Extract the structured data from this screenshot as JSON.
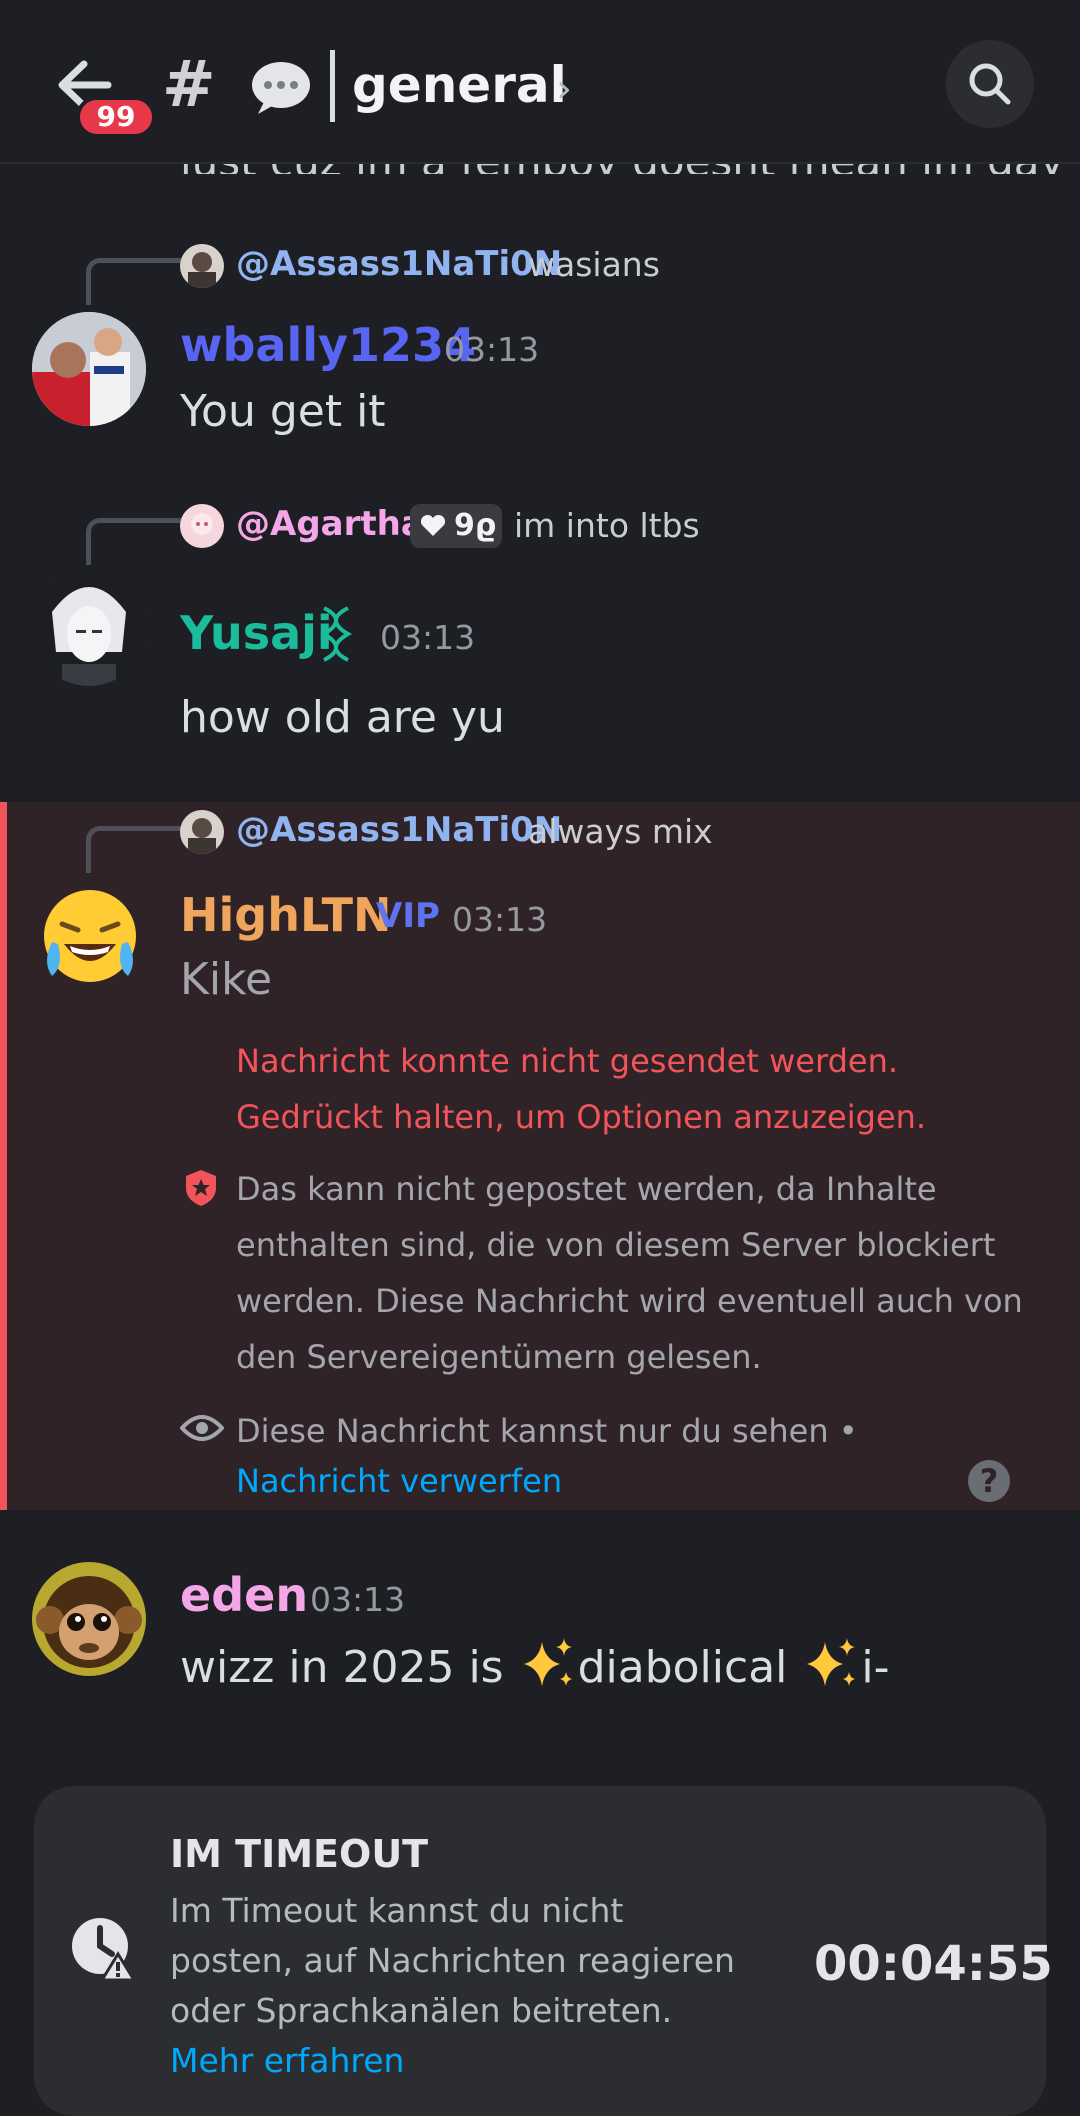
{
  "header": {
    "badge_count": "99",
    "hash": "#",
    "channel_name": "general",
    "chevron": "›"
  },
  "cut_off_message": "just cuz im a femboy doesnt mean im gay",
  "messages": [
    {
      "reply": {
        "mention": "@Assass1NaTi0N",
        "text": "wasians"
      },
      "username": "wbally1234",
      "time": "03:13",
      "text": "You get it"
    },
    {
      "reply": {
        "mention": "@Agartha",
        "tag": "9ϱ",
        "text": "im into ltbs"
      },
      "username": "Yusaji",
      "time": "03:13",
      "text": "how old are yu"
    },
    {
      "reply": {
        "mention": "@Assass1NaTi0N",
        "text": "always mix"
      },
      "username": "HighLTN",
      "role_tag": "VIP",
      "time": "03:13",
      "text": "Kike",
      "error_line1": "Nachricht konnte nicht gesendet werden.",
      "error_line2": "Gedrückt halten, um Optionen anzuzeigen.",
      "block_lines": [
        "Das kann nicht gepostet werden, da Inhalte",
        "enthalten sind, die von diesem Server blockiert",
        "werden. Diese Nachricht wird eventuell auch von",
        "den Servereigentümern gelesen."
      ],
      "only_you": "Diese Nachricht kannst nur du sehen •",
      "discard_link": "Nachricht verwerfen"
    },
    {
      "username": "eden",
      "time": "03:13",
      "text_a": "wizz in 2025 is ",
      "text_b": "diabolical ",
      "text_c": "i-"
    }
  ],
  "timeout": {
    "title": "IM TIMEOUT",
    "description": "Im Timeout kannst du nicht posten, auf Nachrichten reagieren oder Sprachkanälen beitreten.",
    "link": "Mehr erfahren",
    "countdown": "00:04:55"
  },
  "colors": {
    "wbally1234": "#5865f2",
    "Yusaji": "#1abc9c",
    "HighLTN": "#f0a55c",
    "eden": "#f4a6e8",
    "mention": "#8fb4f0",
    "error": "#f2545b",
    "link": "#00a8fc"
  }
}
